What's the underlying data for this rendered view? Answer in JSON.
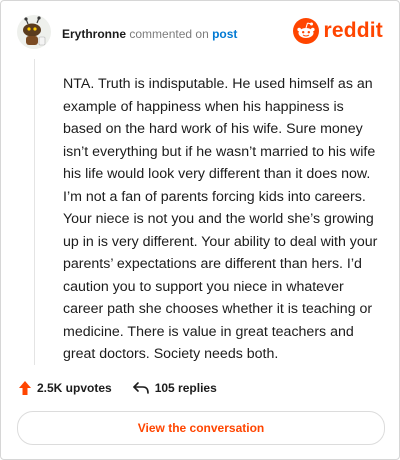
{
  "comment": {
    "username": "Erythronne",
    "action_text": "commented on",
    "post_link": "post",
    "body": "NTA. Truth is indisputable. He used himself as an example of happiness when his happiness is based on the hard work of his wife. Sure money isn’t everything but if he wasn’t married to his wife his life would look very different than it does now. I’m not a fan of parents forcing kids into careers. Your niece is not you and the world she’s growing up in is very different. Your ability to deal with your parents’ expectations are different than hers. I’d caution you to support you niece in whatever career path she chooses whether it is teaching or medicine. There is value in great teachers and great doctors. Society needs both."
  },
  "brand": {
    "logo_text": "reddit",
    "color": "#ff4500",
    "icon": "reddit-logo-icon"
  },
  "footer": {
    "upvotes_label": "2.5K upvotes",
    "replies_label": "105 replies",
    "upvote_icon": "upvote-arrow-icon",
    "reply_icon": "reply-arrow-icon"
  },
  "cta": {
    "label": "View the conversation"
  },
  "colors": {
    "accent": "#ff4500",
    "link": "#0079d3",
    "text": "#1c1c1c",
    "muted": "#7c7c7c",
    "border": "#d6d6d6"
  }
}
